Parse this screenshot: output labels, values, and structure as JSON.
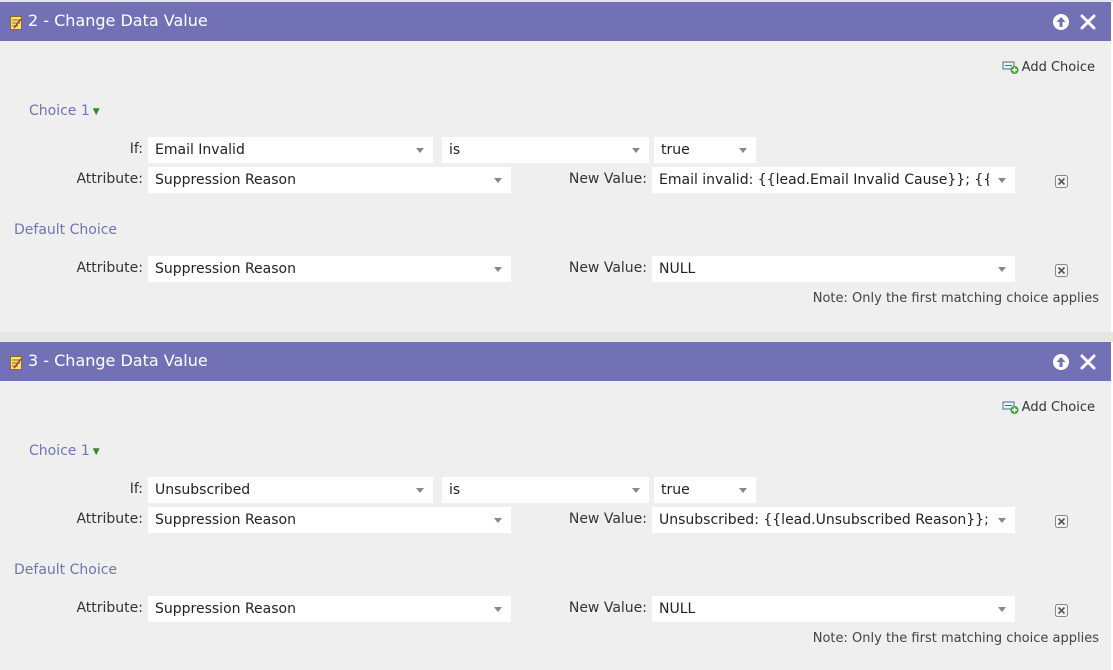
{
  "cards": [
    {
      "title": "2 - Change Data Value",
      "add_choice_label": "Add Choice",
      "choice_label": "Choice 1",
      "if_label": "If:",
      "if_field": "Email Invalid",
      "if_operator": "is",
      "if_value": "true",
      "attribute_label": "Attribute:",
      "attribute_value": "Suppression Reason",
      "new_value_label": "New Value:",
      "new_value": "Email invalid: {{lead.Email Invalid Cause}}; {{lead.Su",
      "default_choice_label": "Default Choice",
      "default_attribute_label": "Attribute:",
      "default_attribute_value": "Suppression Reason",
      "default_new_value_label": "New Value:",
      "default_new_value": "NULL",
      "note": "Note: Only the first matching choice applies"
    },
    {
      "title": "3 - Change Data Value",
      "add_choice_label": "Add Choice",
      "choice_label": "Choice 1",
      "if_label": "If:",
      "if_field": "Unsubscribed",
      "if_operator": "is",
      "if_value": "true",
      "attribute_label": "Attribute:",
      "attribute_value": "Suppression Reason",
      "new_value_label": "New Value:",
      "new_value": "Unsubscribed: {{lead.Unsubscribed Reason}}; {{lead",
      "default_choice_label": "Default Choice",
      "default_attribute_label": "Attribute:",
      "default_attribute_value": "Suppression Reason",
      "default_new_value_label": "New Value:",
      "default_new_value": "NULL",
      "note": "Note: Only the first matching choice applies"
    }
  ],
  "icons": {
    "flow_step": "flow-step-icon",
    "move_up": "move-up-icon",
    "close": "close-icon",
    "add_choice": "add-choice-icon",
    "expand": "chevron-down-icon",
    "delete": "delete-icon",
    "dropdown": "dropdown-caret-icon"
  },
  "colors": {
    "header_bg": "#7371b6",
    "link": "#6f75b0",
    "body_bg": "#efefef",
    "expand_arrow": "#2e8b2e"
  }
}
